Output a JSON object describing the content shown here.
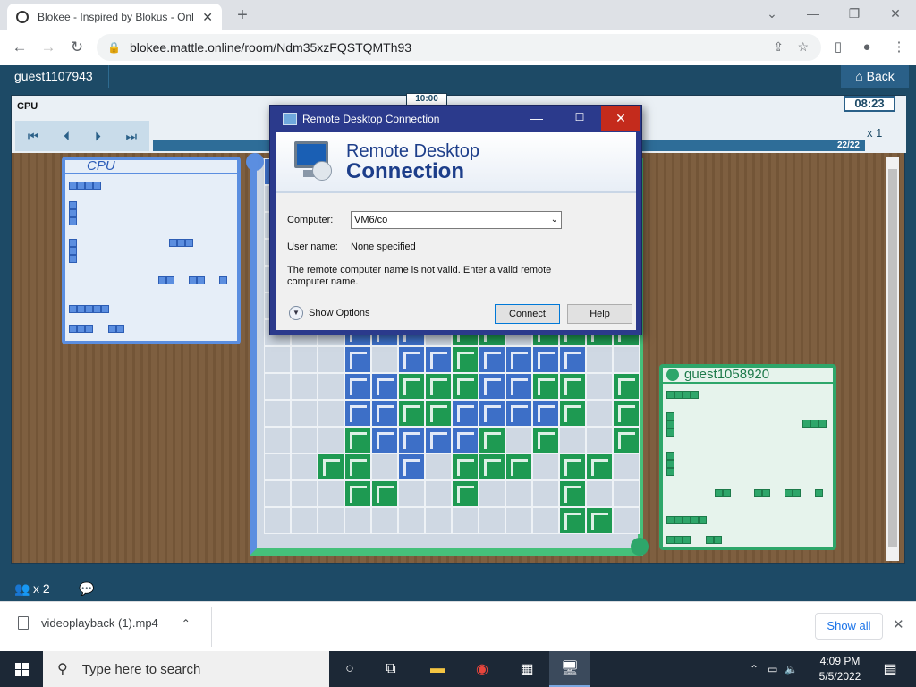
{
  "browser": {
    "tab_title": "Blokee - Inspired by Blokus - Onl",
    "url": "blokee.mattle.online/room/Ndm35xzFQSTQMTh93"
  },
  "app": {
    "user": "guest1107943",
    "back_label": "Back",
    "cpu_label": "CPU",
    "timer_top": "10:00",
    "timer_right": "08:23",
    "progress_label": "22/22",
    "speed_label": "x 1",
    "cpu_panel_name": "CPU",
    "green_panel_name": "guest1058920",
    "players_count": "x 2"
  },
  "dialog": {
    "title": "Remote Desktop Connection",
    "banner_line1": "Remote Desktop",
    "banner_line2": "Connection",
    "computer_label": "Computer:",
    "computer_value": "VM6/co",
    "username_label": "User name:",
    "username_value": "None specified",
    "message": "The remote computer name is not valid. Enter a valid remote computer name.",
    "show_options": "Show Options",
    "connect": "Connect",
    "help": "Help"
  },
  "downloads": {
    "file": "videoplayback (1).mp4",
    "show_all": "Show all"
  },
  "taskbar": {
    "search_placeholder": "Type here to search",
    "time": "4:09 PM",
    "date": "5/5/2022"
  },
  "colors": {
    "blue_player": "#3d6fc7",
    "green_player": "#1e9a52",
    "app_bar": "#1d4a66",
    "dialog_title": "#2b3a8c"
  }
}
